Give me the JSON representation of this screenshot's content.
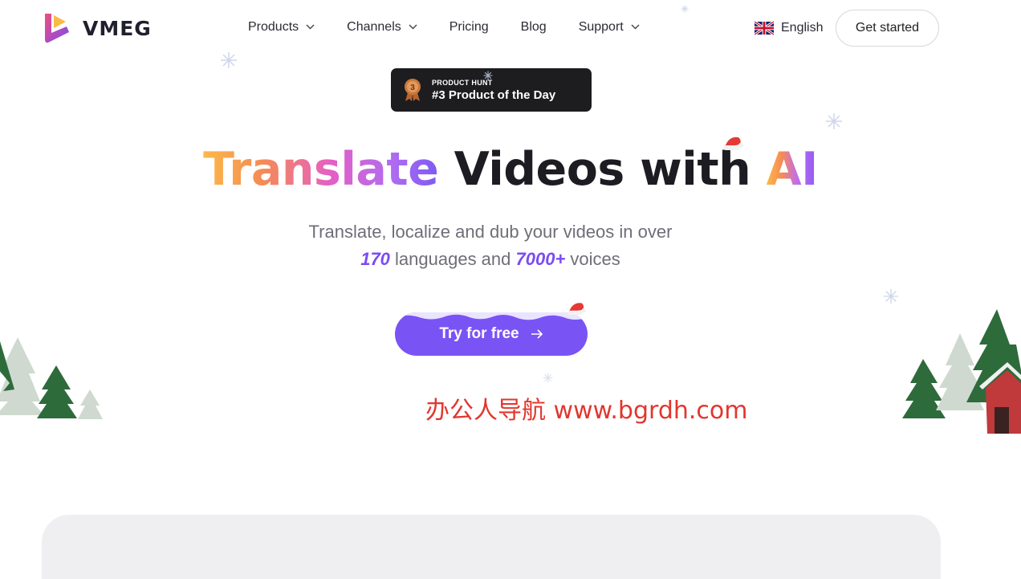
{
  "header": {
    "logo_text": "VMEG",
    "nav": [
      {
        "label": "Products",
        "has_dropdown": true
      },
      {
        "label": "Channels",
        "has_dropdown": true
      },
      {
        "label": "Pricing",
        "has_dropdown": false
      },
      {
        "label": "Blog",
        "has_dropdown": false
      },
      {
        "label": "Support",
        "has_dropdown": true
      }
    ],
    "language": "English",
    "language_flag_icon": "uk-flag-icon",
    "cta_label": "Get started"
  },
  "badge": {
    "rank": "3",
    "source": "PRODUCT HUNT",
    "text": "#3 Product of the Day"
  },
  "hero": {
    "title_highlight": "Translate",
    "title_middle": " Videos with ",
    "title_ai": "AI",
    "subtitle_line1": "Translate, localize and dub your videos in over",
    "languages_count": "170",
    "languages_text": " languages and ",
    "voices_count": "7000+",
    "voices_text": " voices",
    "cta_label": "Try for free",
    "cta_icon": "arrow-right-icon"
  },
  "watermark": "办公人导航 www.bgrdh.com",
  "colors": {
    "accent": "#7a53f5",
    "badge_bg": "#1d1d20",
    "watermark": "#e2362e",
    "tree_dark": "#2e6b3a",
    "tree_light": "#cfd9cf"
  }
}
